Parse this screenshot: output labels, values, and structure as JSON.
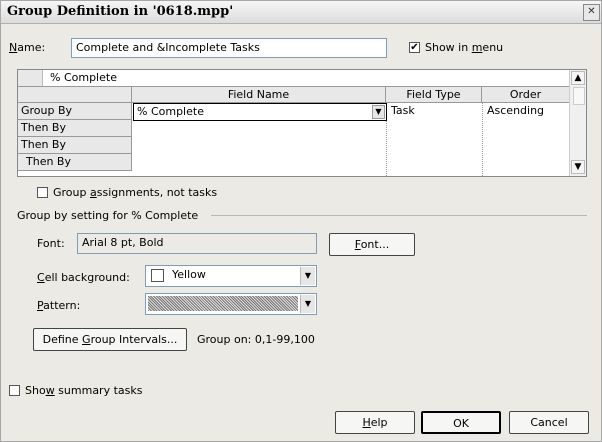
{
  "window": {
    "title": "Group Definition in '0618.mpp'",
    "close_glyph": "✕"
  },
  "name_field": {
    "label_pre": "",
    "label_u": "N",
    "label_post": "ame:",
    "value": "Complete and &Incomplete Tasks"
  },
  "show_in_menu": {
    "checked": true,
    "mark": "✔",
    "label_pre": "Show in ",
    "label_u": "m",
    "label_post": "enu"
  },
  "grid": {
    "edit_value": "% Complete",
    "headers": {
      "field_name": "Field Name",
      "field_type": "Field Type",
      "order": "Order"
    },
    "rows": [
      {
        "label": "Group By",
        "field_name": "% Complete",
        "field_type": "Task",
        "order": "Ascending"
      },
      {
        "label": "Then By",
        "field_name": "",
        "field_type": "",
        "order": ""
      },
      {
        "label": "Then By",
        "field_name": "",
        "field_type": "",
        "order": ""
      },
      {
        "label": "Then By",
        "field_name": "",
        "field_type": "",
        "order": ""
      }
    ]
  },
  "group_assignments": {
    "checked": false,
    "label_pre": "Group ",
    "label_u": "a",
    "label_post": "ssignments, not tasks"
  },
  "group_setting": {
    "heading": "Group by setting for % Complete",
    "font_label": "Font:",
    "font_value": "Arial 8 pt, Bold",
    "font_button": {
      "label_u": "F",
      "label_post": "ont..."
    },
    "cell_bg_label": {
      "label_u": "C",
      "label_post": "ell background:"
    },
    "cell_bg_value": "Yellow",
    "pattern_label": {
      "label_u": "P",
      "label_post": "attern:"
    },
    "define_button": {
      "label_pre": "Define ",
      "label_u": "G",
      "label_post": "roup Intervals..."
    },
    "group_on": "Group on: 0,1-99,100"
  },
  "show_summary": {
    "checked": false,
    "label_pre": "Sho",
    "label_u": "w",
    "label_post": " summary tasks"
  },
  "buttons": {
    "help_u": "H",
    "help_post": "elp",
    "ok": "OK",
    "cancel": "Cancel"
  },
  "icons": {
    "close": "close-icon",
    "dropdown": "chevron-down-icon",
    "scroll_up": "chevron-up-icon",
    "scroll_down": "chevron-down-icon"
  }
}
